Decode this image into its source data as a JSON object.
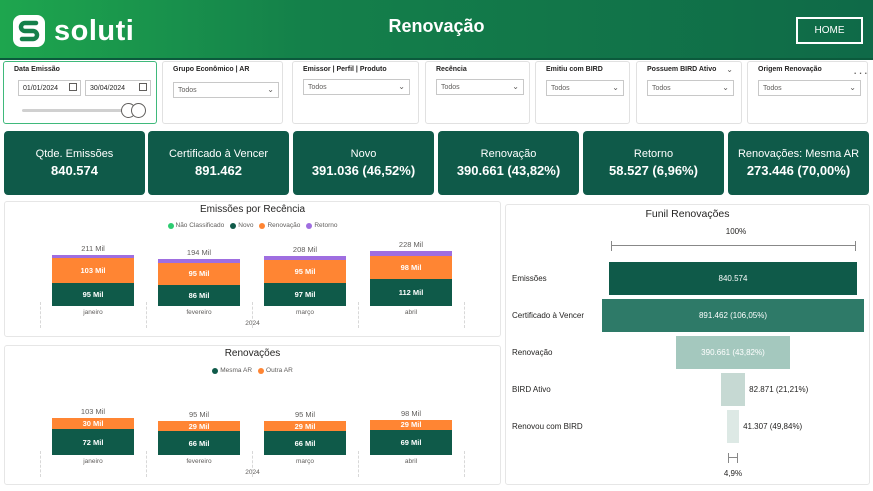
{
  "header": {
    "logo_text": "soluti",
    "title": "Renovação",
    "home_label": "HOME"
  },
  "filters": {
    "date": {
      "title": "Data Emissão",
      "start": "01/01/2024",
      "end": "30/04/2024"
    },
    "dropdowns": [
      {
        "title": "Grupo Econômico | AR",
        "value": "Todos"
      },
      {
        "title": "Emissor | Perfil | Produto",
        "value": "Todos"
      },
      {
        "title": "Recência",
        "value": "Todos"
      },
      {
        "title": "Emitiu com BIRD",
        "value": "Todos"
      },
      {
        "title": "Possuem BIRD Ativo",
        "value": "Todos"
      },
      {
        "title": "Origem Renovação",
        "value": "Todos"
      }
    ],
    "more_icon": "ellipsis-icon"
  },
  "kpis": [
    {
      "label": "Qtde. Emissões",
      "value": "840.574"
    },
    {
      "label": "Certificado à Vencer",
      "value": "891.462"
    },
    {
      "label": "Novo",
      "value": "391.036 (46,52%)"
    },
    {
      "label": "Renovação",
      "value": "390.661 (43,82%)"
    },
    {
      "label": "Retorno",
      "value": "58.527 (6,96%)"
    },
    {
      "label": "Renovações: Mesma AR",
      "value": "273.446 (70,00%)"
    }
  ],
  "colors": {
    "header_dark": "#0f6a48",
    "kpi_bg": "#0f5a49",
    "novo": "#0f5a49",
    "renovacao": "#ff8533",
    "retorno": "#9f6ee0",
    "nao_classificado": "#2ecc71",
    "funnel": [
      "#0f5a49",
      "#2e7a68",
      "#a4c8be",
      "#c6d9d3",
      "#dde9e5"
    ]
  },
  "chart_data": [
    {
      "type": "bar",
      "title": "Emissões por Recência",
      "categories": [
        "janeiro",
        "fevereiro",
        "março",
        "abril"
      ],
      "year_label": "2024",
      "legend": [
        "Não Classificado",
        "Novo",
        "Renovação",
        "Retorno"
      ],
      "series": [
        {
          "name": "Novo",
          "values": [
            95,
            86,
            97,
            112
          ],
          "labels": [
            "95 Mil",
            "86 Mil",
            "97 Mil",
            "112 Mil"
          ]
        },
        {
          "name": "Renovação",
          "values": [
            103,
            95,
            95,
            98
          ],
          "labels": [
            "103 Mil",
            "95 Mil",
            "95 Mil",
            "98 Mil"
          ]
        },
        {
          "name": "Retorno",
          "values": [
            13,
            13,
            16,
            18
          ]
        }
      ],
      "totals": [
        "211 Mil",
        "194 Mil",
        "208 Mil",
        "228 Mil"
      ],
      "total_values": [
        211,
        194,
        208,
        228
      ]
    },
    {
      "type": "bar",
      "title": "Renovações",
      "categories": [
        "janeiro",
        "fevereiro",
        "março",
        "abril"
      ],
      "year_label": "2024",
      "legend": [
        "Mesma AR",
        "Outra AR"
      ],
      "series": [
        {
          "name": "Mesma AR",
          "values": [
            72,
            66,
            66,
            69
          ],
          "labels": [
            "72 Mil",
            "66 Mil",
            "66 Mil",
            "69 Mil"
          ]
        },
        {
          "name": "Outra AR",
          "values": [
            30,
            29,
            29,
            29
          ],
          "labels": [
            "30 Mil",
            "29 Mil",
            "29 Mil",
            "29 Mil"
          ]
        }
      ],
      "totals": [
        "103 Mil",
        "95 Mil",
        "95 Mil",
        "98 Mil"
      ],
      "total_values": [
        103,
        95,
        95,
        98
      ]
    },
    {
      "type": "bar",
      "title": "Funil Renovações",
      "top_label": "100%",
      "bottom_label": "4,9%",
      "categories": [
        "Emissões",
        "Certificado à Vencer",
        "Renovação",
        "BIRD Ativo",
        "Renovou com BIRD"
      ],
      "values": [
        840574,
        891462,
        390661,
        82871,
        41307
      ],
      "labels": [
        "840.574",
        "891.462 (106,05%)",
        "390.661 (43,82%)",
        "82.871 (21,21%)",
        "41.307 (49,84%)"
      ]
    }
  ]
}
